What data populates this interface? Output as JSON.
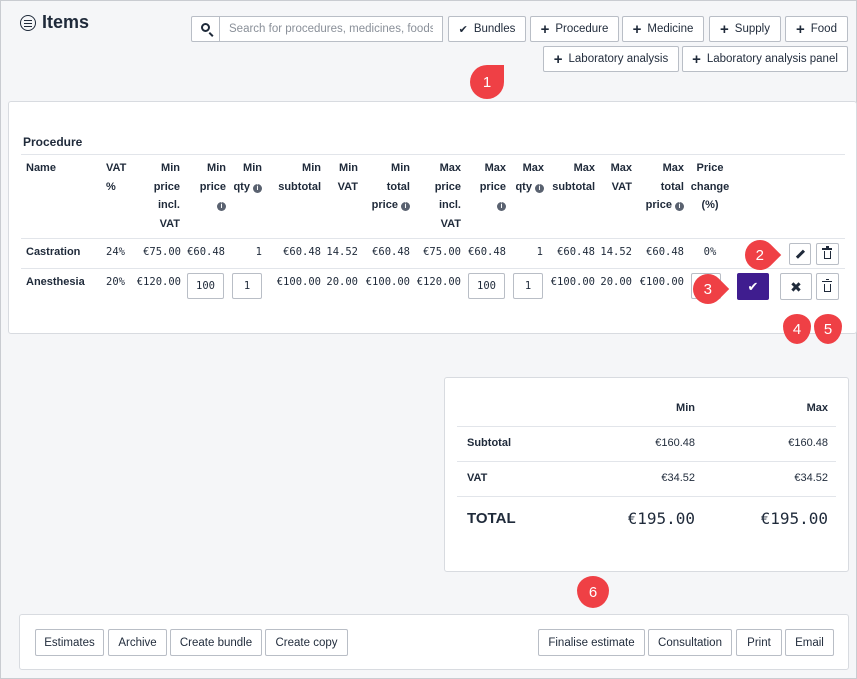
{
  "page": {
    "title": "Items"
  },
  "toolbar": {
    "search_placeholder": "Search for procedures, medicines, foods,",
    "bundles": "Bundles",
    "procedure": "Procedure",
    "medicine": "Medicine",
    "supply": "Supply",
    "food": "Food",
    "lab_analysis": "Laboratory analysis",
    "lab_panel": "Laboratory analysis panel"
  },
  "procedure": {
    "title": "Procedure",
    "headers": {
      "name": "Name",
      "vat_pct": [
        "VAT",
        "%"
      ],
      "min_price_incl": [
        "Min",
        "price",
        "incl.",
        "VAT"
      ],
      "min_price": [
        "Min",
        "price"
      ],
      "min_qty": [
        "Min",
        "qty"
      ],
      "min_subtotal": [
        "Min",
        "subtotal"
      ],
      "min_vat": [
        "Min",
        "VAT"
      ],
      "min_total_price": [
        "Min",
        "total",
        "price"
      ],
      "max_price_incl": [
        "Max",
        "price",
        "incl.",
        "VAT"
      ],
      "max_price": [
        "Max",
        "price"
      ],
      "max_qty": [
        "Max",
        "qty"
      ],
      "max_subtotal": [
        "Max",
        "subtotal"
      ],
      "max_vat": [
        "Max",
        "VAT"
      ],
      "max_total_price": [
        "Max",
        "total",
        "price"
      ],
      "price_change": [
        "Price",
        "change",
        "(%)"
      ]
    },
    "rows": [
      {
        "name": "Castration",
        "vat": "24%",
        "min_incl": "€75.00",
        "min_price": "€60.48",
        "min_qty": "1",
        "min_subtotal": "€60.48",
        "min_vat": "14.52",
        "min_total": "€60.48",
        "max_incl": "€75.00",
        "max_price": "€60.48",
        "max_qty": "1",
        "max_subtotal": "€60.48",
        "max_vat": "14.52",
        "max_total": "€60.48",
        "change": "0%"
      },
      {
        "name": "Anesthesia",
        "vat": "20%",
        "min_incl": "€120.00",
        "min_price": "100",
        "min_qty": "1",
        "min_subtotal": "€100.00",
        "min_vat": "20.00",
        "min_total": "€100.00",
        "max_incl": "€120.00",
        "max_price": "100",
        "max_qty": "1",
        "max_subtotal": "€100.00",
        "max_vat": "20.00",
        "max_total": "€100.00",
        "change": ""
      }
    ]
  },
  "summary": {
    "min_label": "Min",
    "max_label": "Max",
    "subtotal_label": "Subtotal",
    "subtotal_min": "€160.48",
    "subtotal_max": "€160.48",
    "vat_label": "VAT",
    "vat_min": "€34.52",
    "vat_max": "€34.52",
    "total_label": "TOTAL",
    "total_min": "€195.00",
    "total_max": "€195.00"
  },
  "footer": {
    "estimates": "Estimates",
    "archive": "Archive",
    "create_bundle": "Create bundle",
    "create_copy": "Create copy",
    "finalise": "Finalise estimate",
    "consultation": "Consultation",
    "print": "Print",
    "email": "Email"
  },
  "markers": [
    "1",
    "2",
    "3",
    "4",
    "5",
    "6"
  ],
  "colors": {
    "confirm": "#3f1d8f",
    "marker": "#ef4045"
  }
}
